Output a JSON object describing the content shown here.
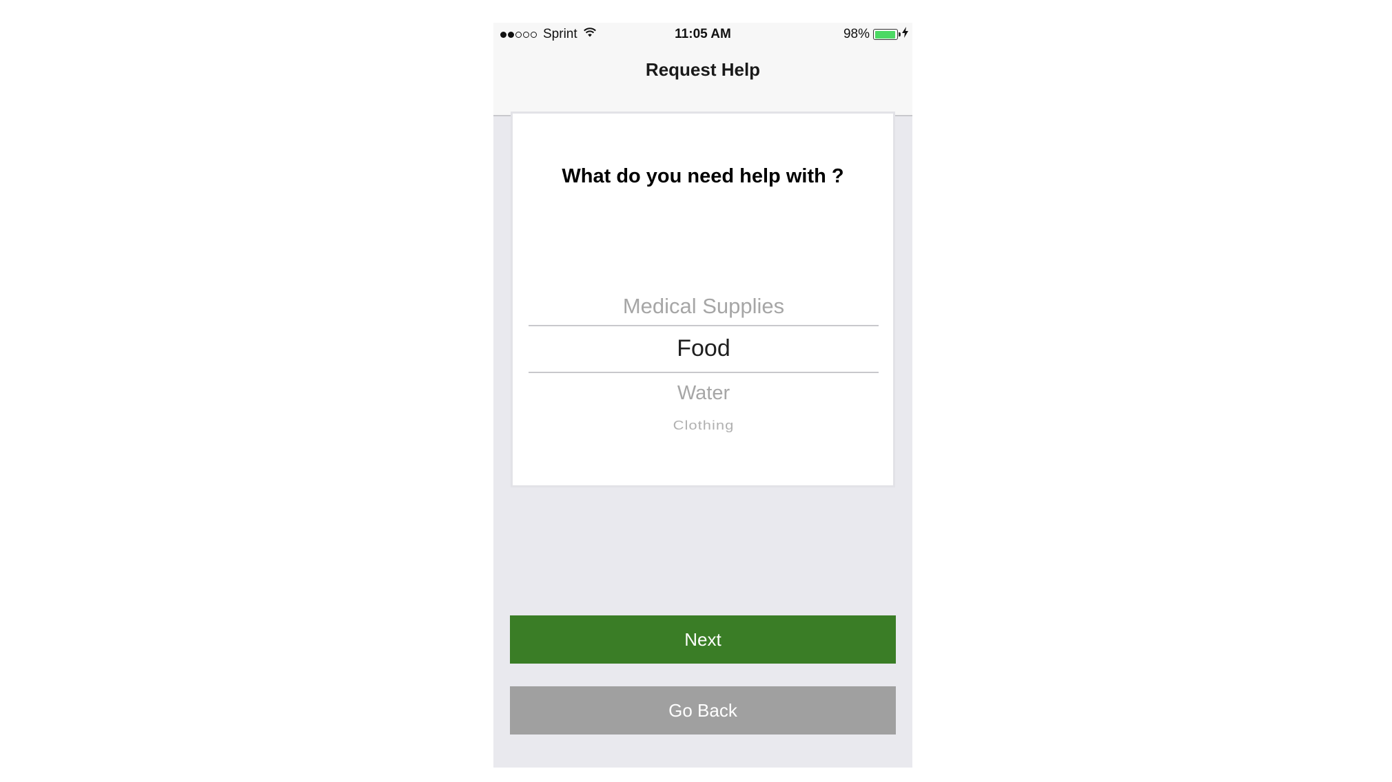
{
  "status_bar": {
    "carrier": "Sprint",
    "time": "11:05 AM",
    "battery_percent": "98%",
    "battery_level": 0.98,
    "signal_bars_filled": 2,
    "signal_bars_total": 5,
    "battery_color": "#4cd964"
  },
  "nav": {
    "title": "Request Help"
  },
  "card": {
    "question": "What do you need help with ?",
    "picker": {
      "options": [
        "Medical Supplies",
        "Food",
        "Water",
        "Clothing"
      ],
      "selected": "Food"
    }
  },
  "buttons": {
    "next_label": "Next",
    "back_label": "Go Back",
    "next_color": "#3a7d26",
    "back_color": "#a0a0a0"
  }
}
